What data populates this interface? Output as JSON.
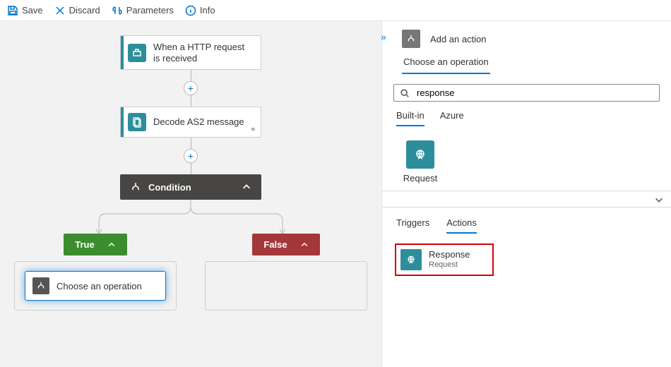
{
  "toolbar": {
    "save": "Save",
    "discard": "Discard",
    "parameters": "Parameters",
    "info": "Info"
  },
  "flow": {
    "http_trigger": "When a HTTP request is received",
    "decode_as2": "Decode AS2 message",
    "condition": "Condition",
    "true_label": "True",
    "false_label": "False",
    "choose_op": "Choose an operation"
  },
  "panel": {
    "header": "Add an action",
    "top_tab": "Choose an operation",
    "search_value": "response",
    "source_tabs": {
      "builtin": "Built-in",
      "azure": "Azure"
    },
    "request_chip": "Request",
    "sub_tabs": {
      "triggers": "Triggers",
      "actions": "Actions"
    },
    "result": {
      "title": "Response",
      "subtitle": "Request"
    }
  }
}
